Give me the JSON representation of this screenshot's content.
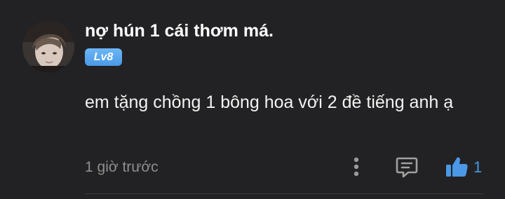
{
  "comment": {
    "username": "nợ hún 1 cái thơm má.",
    "level_badge": "Lv8",
    "text": "em tặng chồng 1 bông hoa với 2 đề tiếng anh ạ",
    "timestamp": "1 giờ trước",
    "like_count": "1",
    "liked": true
  },
  "icons": {
    "avatar": "user-avatar-photo",
    "more": "more-vertical-icon",
    "reply": "comment-reply-icon",
    "like": "thumbs-up-icon"
  },
  "colors": {
    "background": "#222224",
    "accent": "#4a98e6",
    "muted_text": "#8e8e8e",
    "primary_text": "#ffffff"
  }
}
